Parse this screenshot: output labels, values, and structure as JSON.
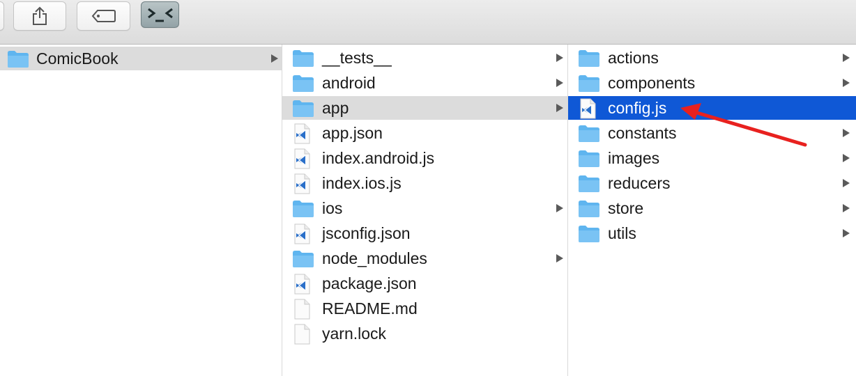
{
  "toolbar": {
    "buttons": [
      {
        "name": "share-button",
        "icon": "share-icon"
      },
      {
        "name": "tag-button",
        "icon": "tag-icon"
      },
      {
        "name": "terminal-button",
        "icon": "terminal-icon"
      }
    ]
  },
  "columns": {
    "col1": {
      "items": [
        {
          "label": "ComicBook",
          "type": "folder",
          "has_children": true,
          "state": "parent-selected"
        }
      ]
    },
    "col2": {
      "items": [
        {
          "label": "__tests__",
          "type": "folder",
          "has_children": true,
          "state": ""
        },
        {
          "label": "android",
          "type": "folder",
          "has_children": true,
          "state": ""
        },
        {
          "label": "app",
          "type": "folder",
          "has_children": true,
          "state": "parent-selected"
        },
        {
          "label": "app.json",
          "type": "vscode-file",
          "has_children": false,
          "state": ""
        },
        {
          "label": "index.android.js",
          "type": "vscode-file",
          "has_children": false,
          "state": ""
        },
        {
          "label": "index.ios.js",
          "type": "vscode-file",
          "has_children": false,
          "state": ""
        },
        {
          "label": "ios",
          "type": "folder",
          "has_children": true,
          "state": ""
        },
        {
          "label": "jsconfig.json",
          "type": "vscode-file",
          "has_children": false,
          "state": ""
        },
        {
          "label": "node_modules",
          "type": "folder",
          "has_children": true,
          "state": ""
        },
        {
          "label": "package.json",
          "type": "vscode-file",
          "has_children": false,
          "state": ""
        },
        {
          "label": "README.md",
          "type": "blank-file",
          "has_children": false,
          "state": ""
        },
        {
          "label": "yarn.lock",
          "type": "blank-file",
          "has_children": false,
          "state": ""
        }
      ]
    },
    "col3": {
      "items": [
        {
          "label": "actions",
          "type": "folder",
          "has_children": true,
          "state": ""
        },
        {
          "label": "components",
          "type": "folder",
          "has_children": true,
          "state": ""
        },
        {
          "label": "config.js",
          "type": "vscode-file",
          "has_children": false,
          "state": "selected"
        },
        {
          "label": "constants",
          "type": "folder",
          "has_children": true,
          "state": ""
        },
        {
          "label": "images",
          "type": "folder",
          "has_children": true,
          "state": ""
        },
        {
          "label": "reducers",
          "type": "folder",
          "has_children": true,
          "state": ""
        },
        {
          "label": "store",
          "type": "folder",
          "has_children": true,
          "state": ""
        },
        {
          "label": "utils",
          "type": "folder",
          "has_children": true,
          "state": ""
        }
      ]
    }
  },
  "colors": {
    "selection_active": "#0f58d6",
    "selection_inactive": "#dcdcdc",
    "folder": "#5fb5ef",
    "vscode": "#2a6fc9",
    "annotation_arrow": "#e8211f"
  }
}
